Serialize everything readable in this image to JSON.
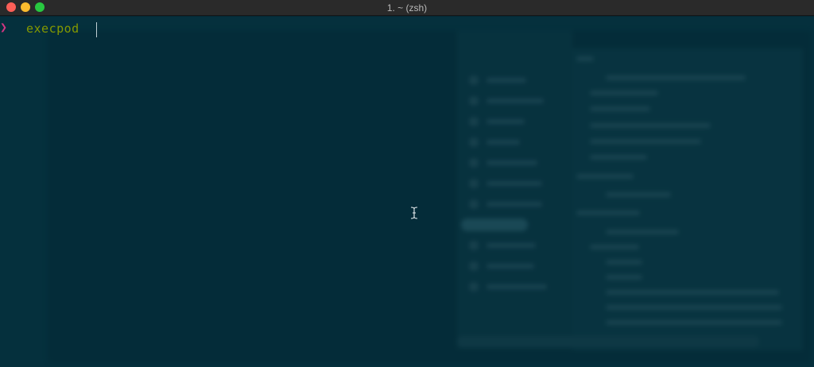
{
  "window": {
    "title": "1. ~ (zsh)",
    "buttons": [
      "close",
      "minimize",
      "maximize"
    ]
  },
  "terminal": {
    "prompt_symbol": "❯",
    "command": "execpod",
    "colors": {
      "background": "#05303d",
      "prompt": "#d33682",
      "command": "#859900"
    }
  },
  "icons": {
    "mouse_cursor": "ibeam-cursor-icon"
  }
}
